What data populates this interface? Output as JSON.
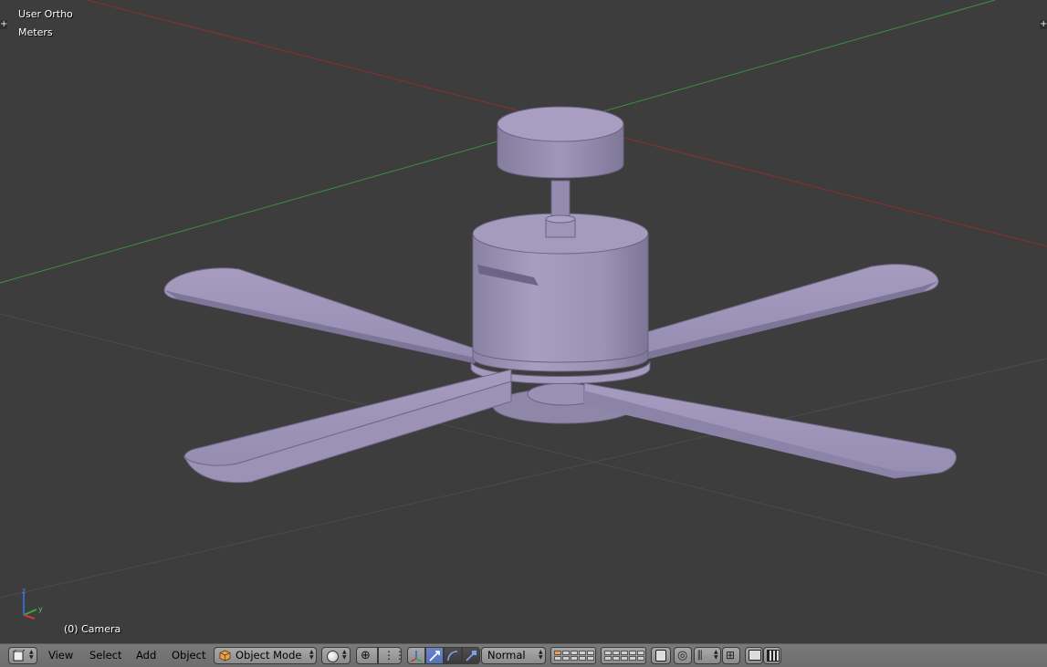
{
  "viewport": {
    "view_name": "User Ortho",
    "units": "Meters",
    "active_object": "(0) Camera",
    "axis_labels": {
      "z": "z",
      "y": "y"
    }
  },
  "header": {
    "menus": [
      "View",
      "Select",
      "Add",
      "Object"
    ],
    "mode": "Object Mode",
    "transform_orientation": "Normal"
  },
  "colors": {
    "viewport_bg": "#3d3d3d",
    "header_bg": "#727272",
    "model": "#9e94b8",
    "x_axis": "#8b2f2f",
    "y_axis": "#3f8f3f",
    "grid": "#4a4a4a"
  }
}
